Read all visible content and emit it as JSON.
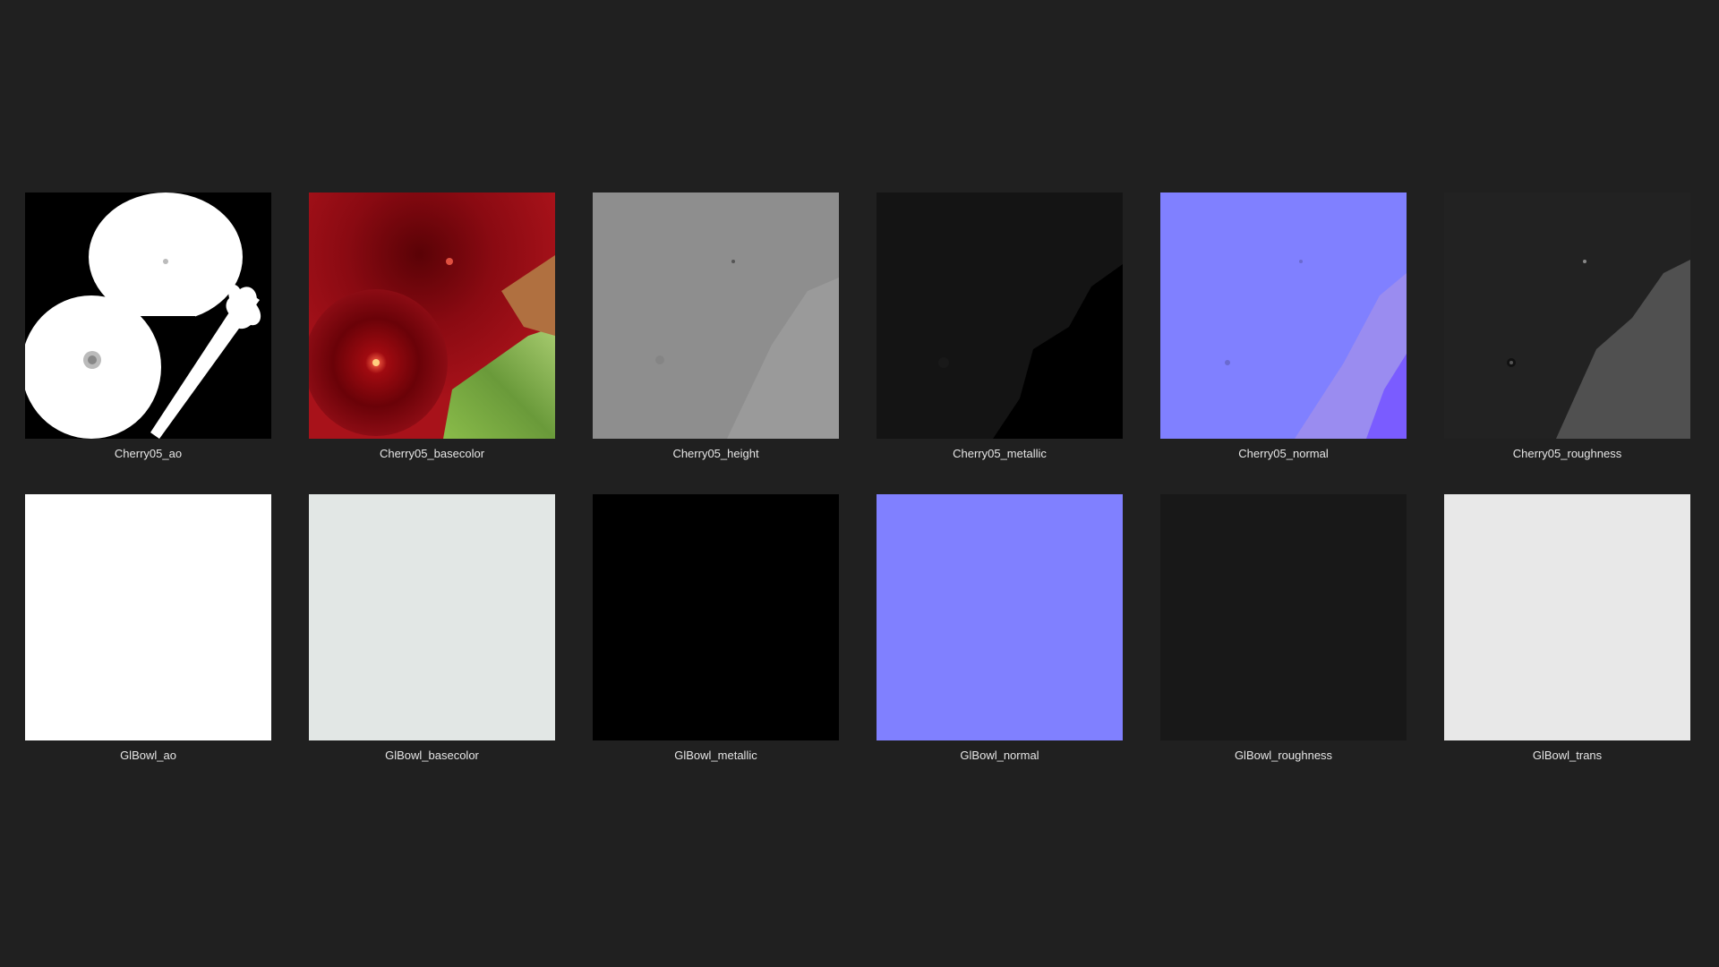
{
  "files": [
    {
      "name": "Cherry05_ao",
      "preview": "ambient-occlusion-map",
      "fill": "#000000"
    },
    {
      "name": "Cherry05_basecolor",
      "preview": "basecolor-map",
      "fill": "#8a0a12"
    },
    {
      "name": "Cherry05_height",
      "preview": "height-map",
      "fill": "#8e8e8e"
    },
    {
      "name": "Cherry05_metallic",
      "preview": "metallic-map",
      "fill": "#141414"
    },
    {
      "name": "Cherry05_normal",
      "preview": "normal-map",
      "fill": "#8080ff"
    },
    {
      "name": "Cherry05_roughness",
      "preview": "roughness-map",
      "fill": "#222222"
    },
    {
      "name": "GlBowl_ao",
      "preview": "solid-fill",
      "fill": "#ffffff"
    },
    {
      "name": "GlBowl_basecolor",
      "preview": "solid-fill",
      "fill": "#e2e7e5"
    },
    {
      "name": "GlBowl_metallic",
      "preview": "solid-fill",
      "fill": "#000000"
    },
    {
      "name": "GlBowl_normal",
      "preview": "solid-fill",
      "fill": "#8080ff"
    },
    {
      "name": "GlBowl_roughness",
      "preview": "solid-fill",
      "fill": "#181818"
    },
    {
      "name": "GlBowl_trans",
      "preview": "solid-fill",
      "fill": "#e8e8e8"
    }
  ]
}
